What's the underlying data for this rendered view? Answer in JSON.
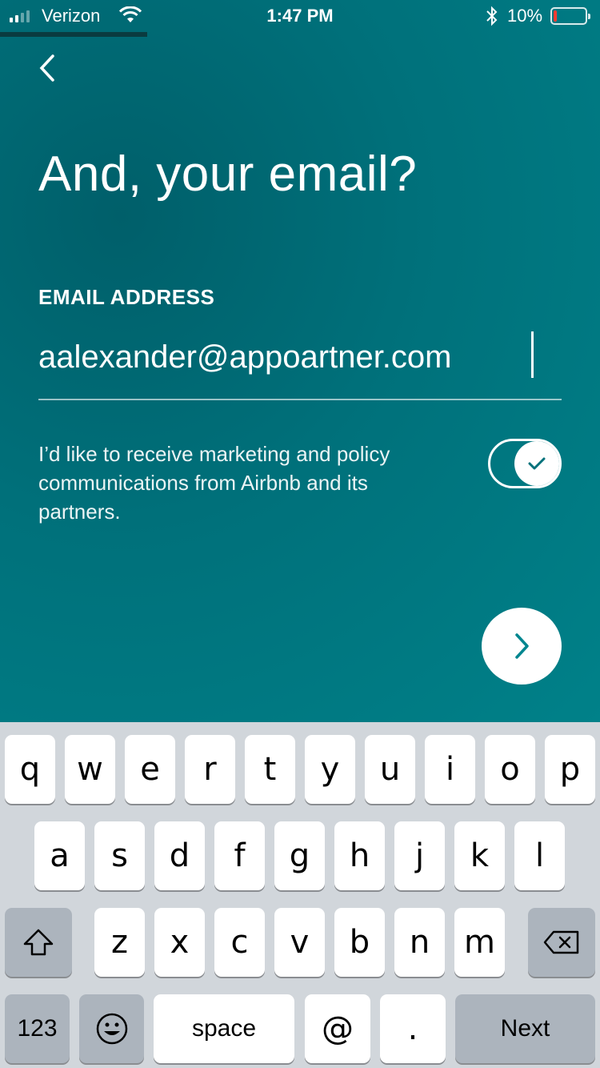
{
  "status_bar": {
    "carrier": "Verizon",
    "time": "1:47 PM",
    "battery": "10%",
    "battery_level": 0.1
  },
  "screen": {
    "title": "And, your email?",
    "field_label": "EMAIL ADDRESS",
    "email_value": "aalexander@appoartner.com",
    "marketing_text": "I’d like to receive marketing and policy communications from Airbnb and its partners.",
    "toggle_on": true
  },
  "keyboard": {
    "row1": [
      "q",
      "w",
      "e",
      "r",
      "t",
      "y",
      "u",
      "i",
      "o",
      "p"
    ],
    "row2": [
      "a",
      "s",
      "d",
      "f",
      "g",
      "h",
      "j",
      "k",
      "l"
    ],
    "row3": [
      "z",
      "x",
      "c",
      "v",
      "b",
      "n",
      "m"
    ],
    "numbers": "123",
    "space": "space",
    "at": "@",
    "dot": ".",
    "next": "Next"
  },
  "icons": [
    "signal-icon",
    "wifi-icon",
    "bluetooth-icon",
    "battery-icon",
    "back-chevron-icon",
    "check-icon",
    "next-arrow-icon",
    "shift-icon",
    "emoji-icon",
    "delete-icon"
  ]
}
